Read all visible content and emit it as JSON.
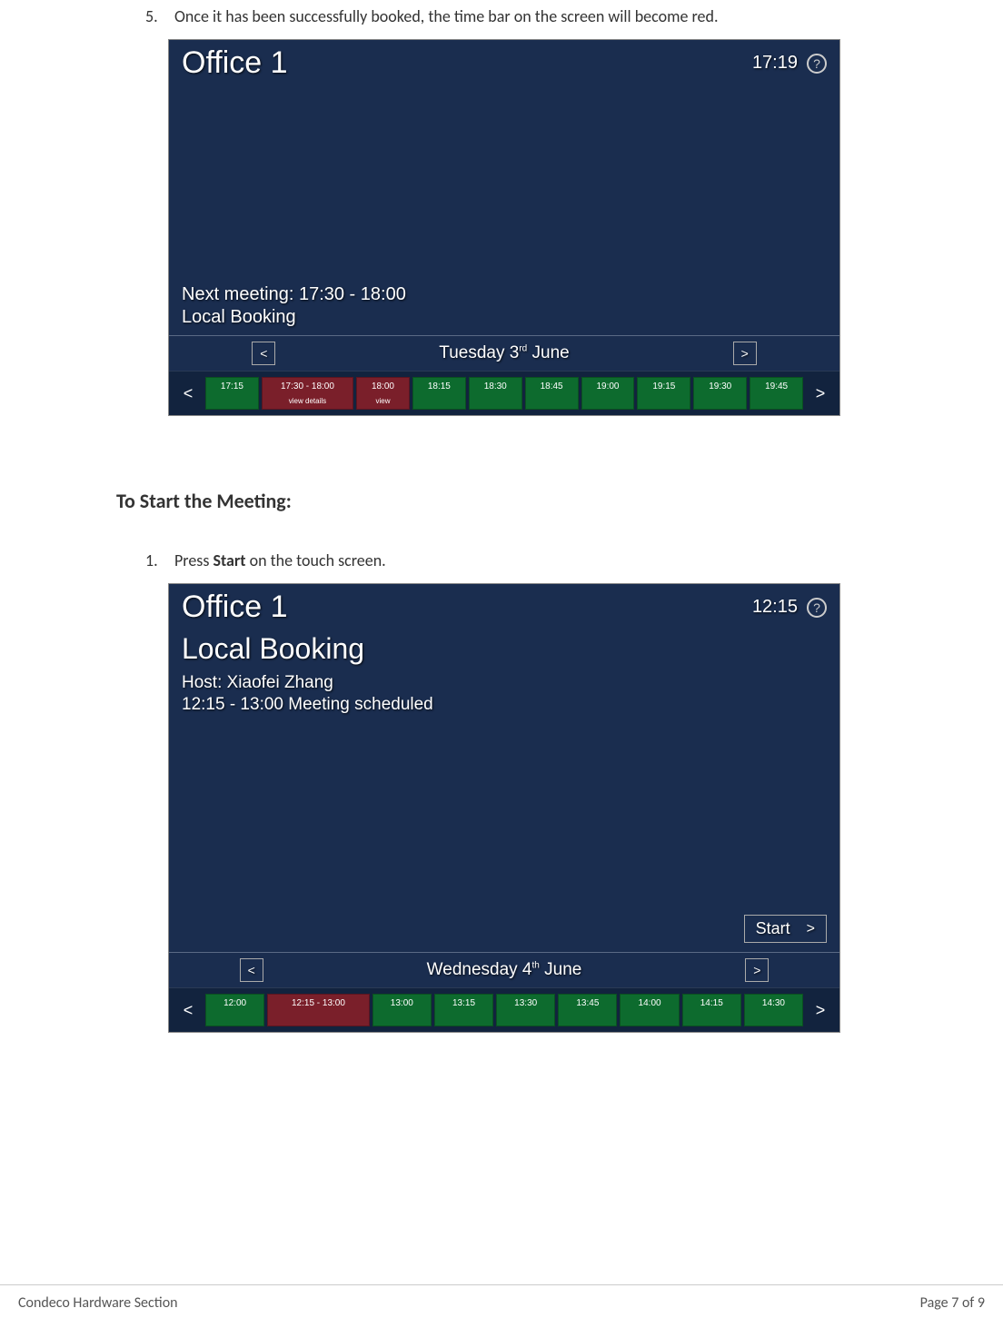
{
  "step5": {
    "num": "5.",
    "text_before": "Once it has been successfully booked, the time bar on the screen will become red."
  },
  "screen1": {
    "room": "Office 1",
    "clock": "17:19",
    "help": "?",
    "next_meeting": "Next meeting: 17:30 - 18:00",
    "booking": "Local Booking",
    "date_prefix": "Tuesday 3",
    "date_sup": "rd",
    "date_suffix": " June",
    "prev": "<",
    "next": ">",
    "prev2": "<",
    "next2": ">",
    "slots": [
      {
        "label": "17:15",
        "sub": "",
        "color": "green",
        "wide": false
      },
      {
        "label": "17:30 - 18:00",
        "sub": "view details",
        "color": "red",
        "wide": true
      },
      {
        "label": "18:00",
        "sub": "view",
        "color": "red",
        "wide": false
      },
      {
        "label": "18:15",
        "sub": "",
        "color": "green",
        "wide": false
      },
      {
        "label": "18:30",
        "sub": "",
        "color": "green",
        "wide": false
      },
      {
        "label": "18:45",
        "sub": "",
        "color": "green",
        "wide": false
      },
      {
        "label": "19:00",
        "sub": "",
        "color": "green",
        "wide": false
      },
      {
        "label": "19:15",
        "sub": "",
        "color": "green",
        "wide": false
      },
      {
        "label": "19:30",
        "sub": "",
        "color": "green",
        "wide": false
      },
      {
        "label": "19:45",
        "sub": "",
        "color": "green",
        "wide": false
      }
    ]
  },
  "heading2": "To Start the Meeting:",
  "step1b": {
    "num": "1.",
    "prefix": "Press ",
    "bold": "Start",
    "suffix": " on the touch screen."
  },
  "screen2": {
    "room": "Office 1",
    "clock": "12:15",
    "help": "?",
    "title": "Local Booking",
    "host": "Host: Xiaofei Zhang",
    "sched": "12:15 - 13:00 Meeting scheduled",
    "start": "Start",
    "start_chev": ">",
    "date_prefix": "Wednesday 4",
    "date_sup": "th",
    "date_suffix": " June",
    "prev": "<",
    "next": ">",
    "prev2": "<",
    "next2": ">",
    "slots": [
      {
        "label": "12:00",
        "sub": "",
        "color": "green",
        "wide": false
      },
      {
        "label": "12:15 - 13:00",
        "sub": "",
        "color": "red",
        "wide": true
      },
      {
        "label": "13:00",
        "sub": "",
        "color": "green",
        "wide": false
      },
      {
        "label": "13:15",
        "sub": "",
        "color": "green",
        "wide": false
      },
      {
        "label": "13:30",
        "sub": "",
        "color": "green",
        "wide": false
      },
      {
        "label": "13:45",
        "sub": "",
        "color": "green",
        "wide": false
      },
      {
        "label": "14:00",
        "sub": "",
        "color": "green",
        "wide": false
      },
      {
        "label": "14:15",
        "sub": "",
        "color": "green",
        "wide": false
      },
      {
        "label": "14:30",
        "sub": "",
        "color": "green",
        "wide": false
      }
    ]
  },
  "footer": {
    "left": "Condeco Hardware Section",
    "right": "Page 7 of 9"
  }
}
